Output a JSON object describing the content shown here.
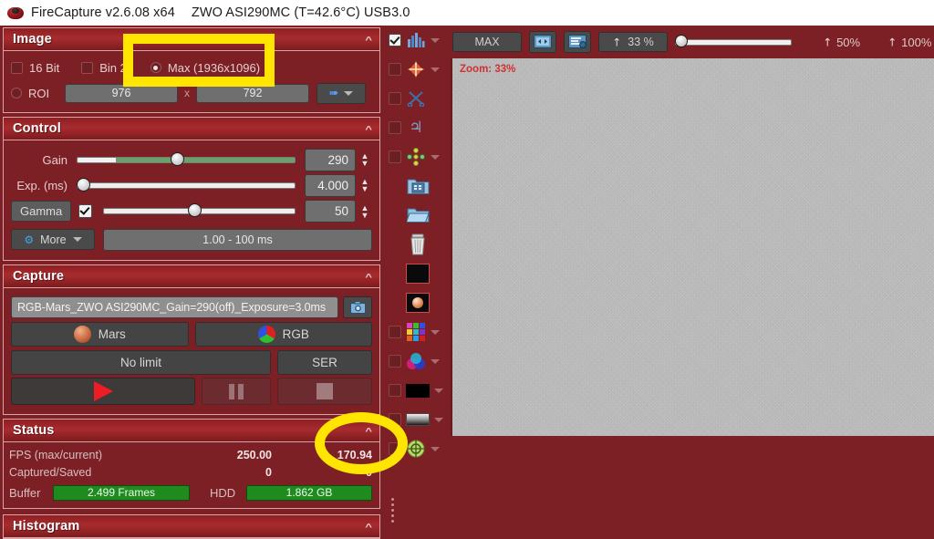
{
  "titlebar": {
    "app_icon": "camera-lens-icon",
    "app_title": "FireCapture v2.6.08  x64",
    "camera_info": "ZWO ASI290MC (T=42.6°C) USB3.0"
  },
  "panels": {
    "image": {
      "title": "Image",
      "collapse_icon": "chevron-up-icon",
      "bit16_label": "16 Bit",
      "bit16_checked": false,
      "bin2_label": "Bin 2",
      "bin2_checked": false,
      "max_label": "Max (1936x1096)",
      "max_selected": true,
      "roi_label": "ROI",
      "roi_selected": false,
      "roi_width": "976",
      "roi_height": "792",
      "roi_separator": "x",
      "roi_arrow_icon": "blue-arrow-icon",
      "roi_dropdown_icon": "chevron-down-icon"
    },
    "control": {
      "title": "Control",
      "collapse_icon": "chevron-up-icon",
      "gain_label": "Gain",
      "gain_value": "290",
      "gain_percent": 45,
      "exposure_label": "Exp. (ms)",
      "exposure_value": "4.000",
      "exposure_percent": 2,
      "gamma_label": "Gamma",
      "gamma_checked": true,
      "gamma_value": "50",
      "gamma_percent": 47,
      "more_label": "More",
      "more_icon": "gear-icon",
      "more_dropdown_icon": "chevron-down-icon",
      "range_label": "1.00 - 100 ms"
    },
    "capture": {
      "title": "Capture",
      "collapse_icon": "chevron-up-icon",
      "filename": "RGB-Mars_ZWO ASI290MC_Gain=290(off)_Exposure=3.0ms",
      "snapshot_icon": "camera-snapshot-icon",
      "target_label": "Mars",
      "target_icon": "mars-planet-icon",
      "colorspace_label": "RGB",
      "colorspace_icon": "rgb-color-wheel-icon",
      "limit_label": "No limit",
      "format_label": "SER",
      "record_icon": "play-record-icon",
      "pause_icon": "pause-icon",
      "stop_icon": "stop-icon"
    },
    "status": {
      "title": "Status",
      "collapse_icon": "chevron-up-icon",
      "rows": [
        {
          "label": "FPS (max/current)",
          "value1": "250.00",
          "value2": "170.94"
        },
        {
          "label": "Captured/Saved",
          "value1": "0",
          "value2": "0"
        }
      ],
      "buffer_label": "Buffer",
      "buffer_value": "2.499 Frames",
      "hdd_label": "HDD",
      "hdd_value": "1.862 GB"
    },
    "histogram": {
      "title": "Histogram",
      "collapse_icon": "chevron-up-icon"
    }
  },
  "icon_strip": {
    "items": [
      {
        "name": "histogram-icon",
        "checkbox": true,
        "checked": true,
        "caret": true
      },
      {
        "name": "align-target-icon",
        "checkbox": true,
        "checked": false,
        "caret": true
      },
      {
        "name": "scissors-icon",
        "checkbox": true,
        "checked": false,
        "caret": false
      },
      {
        "name": "jupiter-icon",
        "checkbox": true,
        "checked": false,
        "caret": false
      },
      {
        "name": "move-arrows-icon",
        "checkbox": true,
        "checked": false,
        "caret": true
      },
      {
        "name": "save-folder-icon",
        "checkbox": false,
        "checked": false,
        "caret": false
      },
      {
        "name": "open-folder-icon",
        "checkbox": false,
        "checked": false,
        "caret": false
      },
      {
        "name": "trash-icon",
        "checkbox": false,
        "checked": false,
        "caret": false
      },
      {
        "name": "black-frame-icon",
        "checkbox": false,
        "checked": false,
        "caret": false
      },
      {
        "name": "planet-preview-icon",
        "checkbox": false,
        "checked": false,
        "caret": false
      },
      {
        "name": "color-palette-icon",
        "checkbox": true,
        "checked": false,
        "caret": true
      },
      {
        "name": "color-balance-icon",
        "checkbox": true,
        "checked": false,
        "caret": true
      },
      {
        "name": "black-level-icon",
        "checkbox": true,
        "checked": false,
        "caret": true
      },
      {
        "name": "gradient-bar-icon",
        "checkbox": true,
        "checked": false,
        "caret": true
      },
      {
        "name": "focus-target-icon",
        "checkbox": true,
        "checked": false,
        "caret": true
      }
    ]
  },
  "preview_toolbar": {
    "max_label": "MAX",
    "fit_screen_icon": "fit-to-screen-icon",
    "screen_settings_icon": "screen-settings-icon",
    "zoom_value_label": "33 %",
    "zoom_icon": "zoom-arrow-icon",
    "zoom_slider_percent": 6,
    "zoom_50_label": "50%",
    "zoom_100_label": "100%"
  },
  "preview": {
    "zoom_overlay": "Zoom: 33%",
    "content": "noise-image"
  },
  "annotations": {
    "rect_highlight_target": "max-resolution-radio",
    "ellipse_highlight_target": "fps-current-value",
    "color": "#ffe500"
  },
  "colors": {
    "background": "#7d2025",
    "panel_border": "#d9a4a6",
    "accent_yellow": "#ffe500",
    "status_green": "#1f8b1f",
    "record_red": "#ee1c24"
  }
}
